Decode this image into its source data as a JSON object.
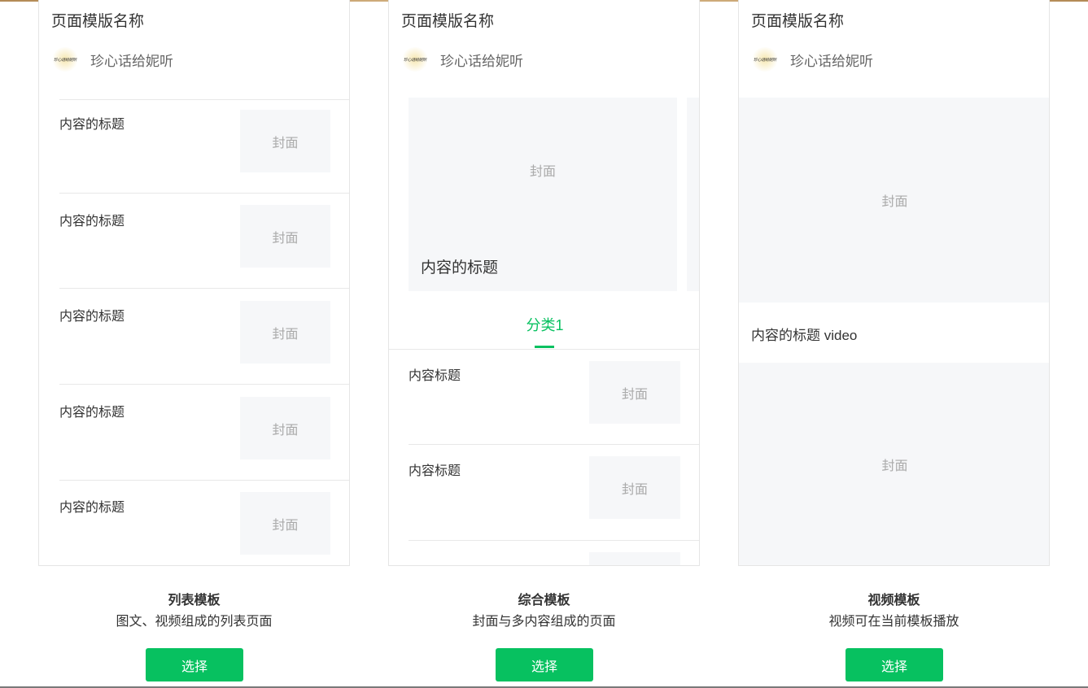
{
  "templates": [
    {
      "page_name": "页面模版名称",
      "author": "珍心话给妮听",
      "items": [
        {
          "title": "内容的标题",
          "cover": "封面"
        },
        {
          "title": "内容的标题",
          "cover": "封面"
        },
        {
          "title": "内容的标题",
          "cover": "封面"
        },
        {
          "title": "内容的标题",
          "cover": "封面"
        },
        {
          "title": "内容的标题",
          "cover": "封面"
        }
      ],
      "name": "列表模板",
      "description": "图文、视频组成的列表页面",
      "button": "选择"
    },
    {
      "page_name": "页面模版名称",
      "author": "珍心话给妮听",
      "hero": {
        "cover": "封面",
        "title": "内容的标题"
      },
      "tab": "分类1",
      "items": [
        {
          "title": "内容标题",
          "cover": "封面"
        },
        {
          "title": "内容标题",
          "cover": "封面"
        }
      ],
      "name": "综合模板",
      "description": "封面与多内容组成的页面",
      "button": "选择"
    },
    {
      "page_name": "页面模版名称",
      "author": "珍心话给妮听",
      "video_cover": "封面",
      "video_title": "内容的标题 video",
      "second_cover": "封面",
      "name": "视频模板",
      "description": "视频可在当前模板播放",
      "button": "选择"
    }
  ],
  "colors": {
    "accent": "#07c160",
    "cover_bg": "#f6f7f9",
    "border": "#e5e5e5"
  },
  "icons": [
    "author-avatar-icon"
  ]
}
